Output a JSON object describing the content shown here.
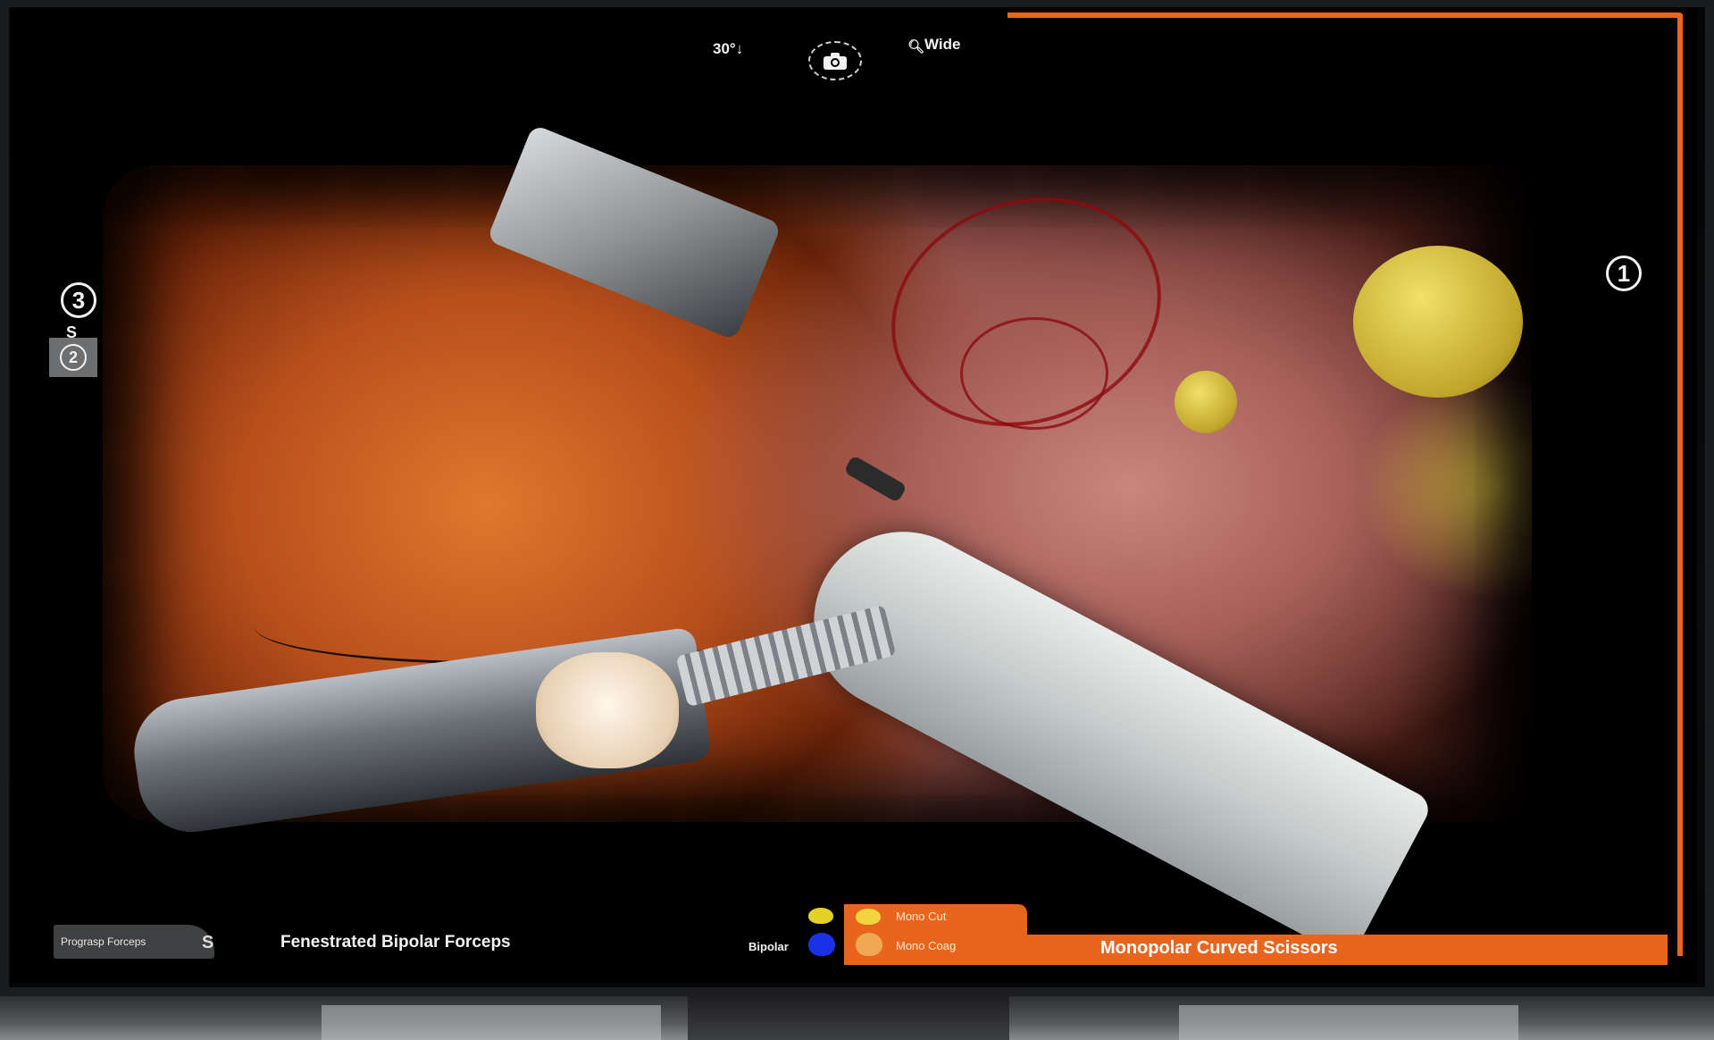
{
  "hud": {
    "scope_angle": "30°↓",
    "zoom_label": "Wide",
    "camera_icon": "camera-icon",
    "magnifier_icon": "magnifier-icon"
  },
  "arms": {
    "left_arm_number": "3",
    "swap_symbol": "S",
    "swap_arm_number": "2",
    "right_arm_number": "1"
  },
  "instruments": {
    "inactive_tool": "Prograsp Forceps",
    "inactive_swap_symbol": "S",
    "left_tool": "Fenestrated Bipolar Forceps",
    "left_energy": "Bipolar",
    "right_energy_cut": "Mono Cut",
    "right_energy_coag": "Mono Coag",
    "right_tool": "Monopolar Curved Scissors"
  },
  "colors": {
    "active_arm": "#e8651e",
    "pedal_yellow": "#e3d127",
    "pedal_blue": "#1932e6",
    "pedal_orange": "#f0a852"
  }
}
